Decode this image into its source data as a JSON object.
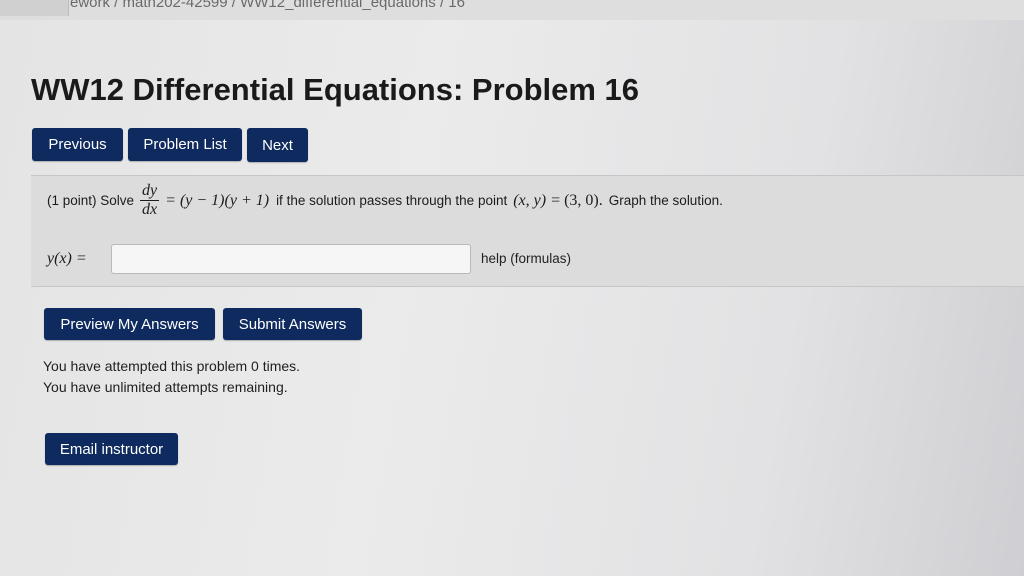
{
  "header": {
    "breadcrumb": "ework / math202-42599 / WW12_differential_equations / 16",
    "title": "WW12 Differential Equations: Problem 16"
  },
  "nav": {
    "previous_label": "Previous",
    "problem_list_label": "Problem List",
    "next_label": "Next"
  },
  "problem": {
    "points": "(1 point) Solve",
    "numerator": "dy",
    "denominator": "dx",
    "equation_rhs": "= (y − 1)(y + 1)",
    "condition_text": "if the solution passes through the point",
    "point_vars": "(x, y)",
    "point_equals": "= (3, 0).",
    "instruction": "Graph the solution.",
    "answer_label": "y(x) =",
    "answer_value": "",
    "answer_placeholder": "",
    "help_link": "help (formulas)"
  },
  "actions": {
    "preview_label": "Preview My Answers",
    "submit_label": "Submit Answers",
    "email_label": "Email instructor"
  },
  "status": {
    "attempts": "You have attempted this problem 0 times.",
    "remaining": "You have unlimited attempts remaining."
  },
  "colors": {
    "button_bg": "#0e2a5e",
    "button_text": "#ffffff",
    "problem_bg": "#dcdcdc"
  }
}
